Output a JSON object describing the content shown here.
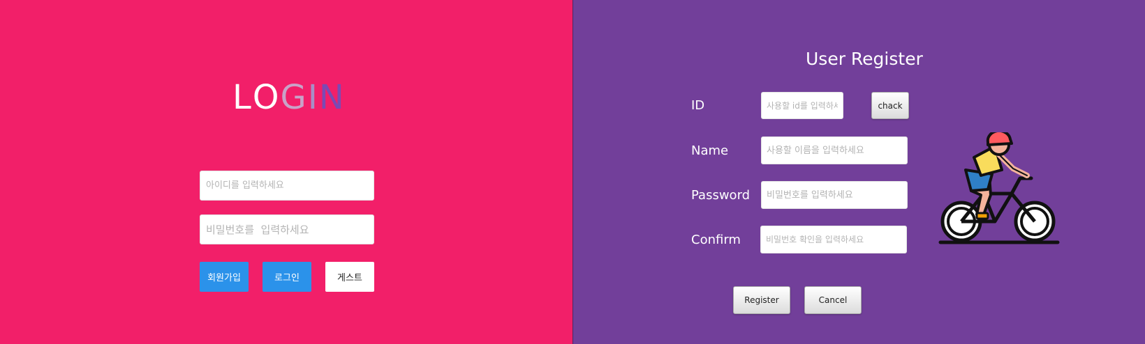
{
  "login": {
    "title_letters": [
      {
        "char": "L",
        "color": "#ffffff"
      },
      {
        "char": "O",
        "color": "#ffffff"
      },
      {
        "char": "G",
        "color": "#c9a2c8"
      },
      {
        "char": "I",
        "color": "#a88ec6"
      },
      {
        "char": "N",
        "color": "#7b4ab4"
      }
    ],
    "id_placeholder": "아이디를 입력하세요",
    "password_placeholder": "비밀번호를  입력하세요",
    "signup_label": "회원가입",
    "login_label": "로그인",
    "guest_label": "게스트",
    "colors": {
      "background": "#f21f69",
      "primary_button": "#2b92ea"
    }
  },
  "register": {
    "title": "User Register",
    "id_label": "ID",
    "name_label": "Name",
    "password_label": "Password",
    "confirm_label": "Confirm",
    "id_placeholder": "사용할 id를 입력하세요",
    "name_placeholder": "사용할 이름을 입력하세요",
    "password_placeholder": "비밀번호를 입력하세요",
    "confirm_placeholder": "비밀번호 확인을 입력하세요",
    "check_label": "chack",
    "register_label": "Register",
    "cancel_label": "Cancel",
    "illustration_icon": "cyclist-icon",
    "colors": {
      "background": "#723f9a"
    }
  }
}
